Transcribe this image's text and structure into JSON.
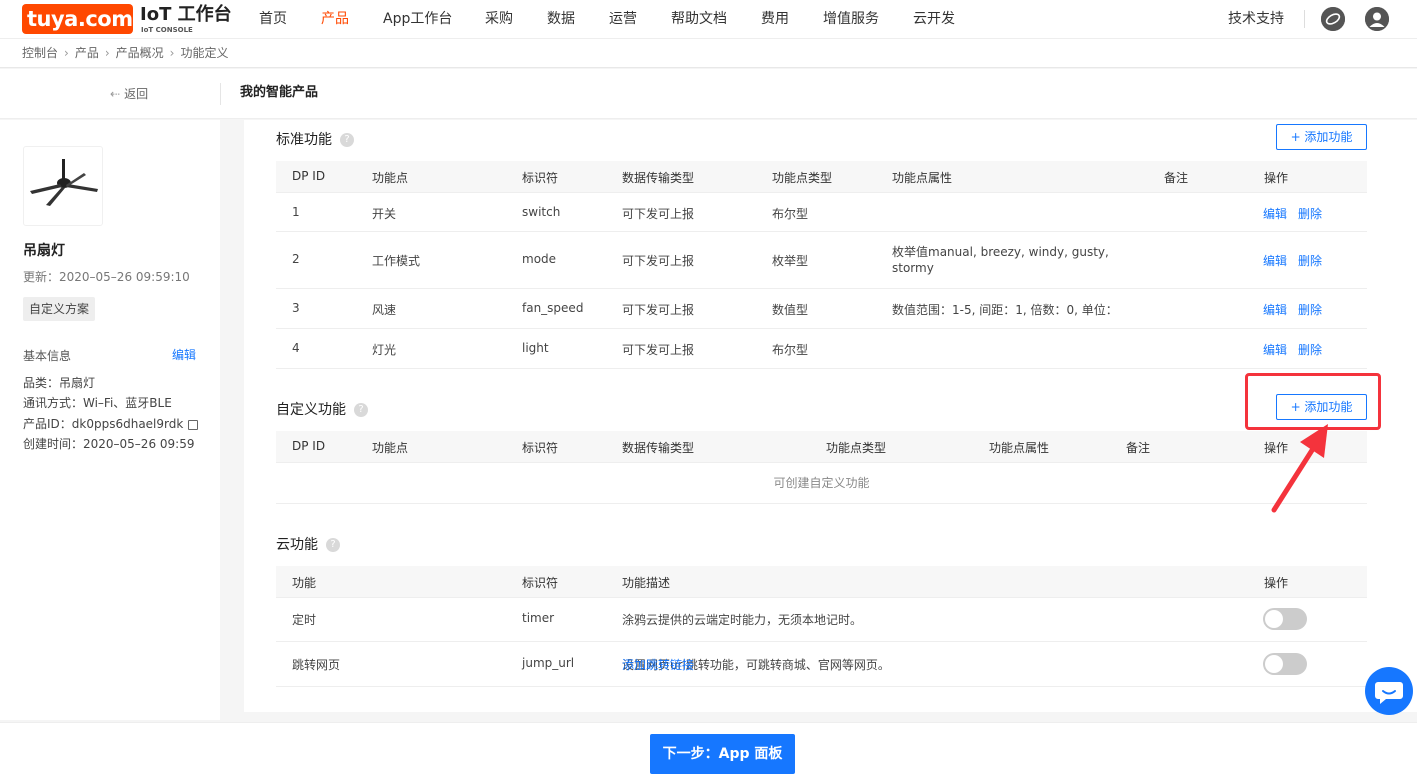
{
  "logo": {
    "text": "tuya.com"
  },
  "header": {
    "title": "IoT 工作台",
    "subtitle": "IoT CONSOLE",
    "nav": [
      "首页",
      "产品",
      "App工作台",
      "采购",
      "数据",
      "运营",
      "帮助文档",
      "费用",
      "增值服务",
      "云开发"
    ],
    "active_nav": "产品",
    "support": "技术支持"
  },
  "breadcrumb": [
    "控制台",
    "产品",
    "产品概况",
    "功能定义"
  ],
  "subheader": {
    "back": "返回",
    "title": "我的智能产品"
  },
  "sidebar": {
    "product_name": "吊扇灯",
    "updated": "更新：2020–05–26 09:59:10",
    "tag": "自定义方案",
    "info_title": "基本信息",
    "edit": "编辑",
    "category": "品类：吊扇灯",
    "protocol": "通讯方式：Wi–Fi、蓝牙BLE",
    "product_id": "产品ID：dk0pps6dhael9rdk",
    "created": "创建时间：2020–05–26 09:59"
  },
  "standard": {
    "title": "标准功能",
    "add_btn": "+ 添加功能",
    "headers": [
      "DP ID",
      "功能点",
      "标识符",
      "数据传输类型",
      "功能点类型",
      "功能点属性",
      "备注",
      "操作"
    ],
    "rows": [
      {
        "id": "1",
        "name": "开关",
        "code": "switch",
        "trans": "可下发可上报",
        "type": "布尔型",
        "prop": "",
        "prop2": "",
        "edit": "编辑",
        "del": "删除"
      },
      {
        "id": "2",
        "name": "工作模式",
        "code": "mode",
        "trans": "可下发可上报",
        "type": "枚举型",
        "prop": "枚举值manual, breezy, windy, gusty,",
        "prop2": "stormy",
        "edit": "编辑",
        "del": "删除"
      },
      {
        "id": "3",
        "name": "风速",
        "code": "fan_speed",
        "trans": "可下发可上报",
        "type": "数值型",
        "prop": "数值范围：1-5, 间距：1, 倍数：0, 单位：",
        "prop2": "",
        "edit": "编辑",
        "del": "删除"
      },
      {
        "id": "4",
        "name": "灯光",
        "code": "light",
        "trans": "可下发可上报",
        "type": "布尔型",
        "prop": "",
        "prop2": "",
        "edit": "编辑",
        "del": "删除"
      }
    ]
  },
  "custom": {
    "title": "自定义功能",
    "add_btn": "+ 添加功能",
    "headers": [
      "DP ID",
      "功能点",
      "标识符",
      "数据传输类型",
      "功能点类型",
      "功能点属性",
      "备注",
      "操作"
    ],
    "empty": "可创建自定义功能"
  },
  "cloud": {
    "title": "云功能",
    "headers": [
      "功能",
      "标识符",
      "功能描述",
      "操作"
    ],
    "rows": [
      {
        "name": "定时",
        "code": "timer",
        "desc": "涂鸦云提供的云端定时能力，无须本地记时。",
        "link": ""
      },
      {
        "name": "跳转网页",
        "code": "jump_url",
        "desc": "设置网页url跳转功能，可跳转商城、官网等网页。",
        "link": "添加跳转链接"
      }
    ]
  },
  "footer": {
    "next": "下一步：App 面板"
  },
  "colors": {
    "brand": "#ff4800",
    "accent": "#1677ff",
    "highlight": "#f4333c"
  }
}
